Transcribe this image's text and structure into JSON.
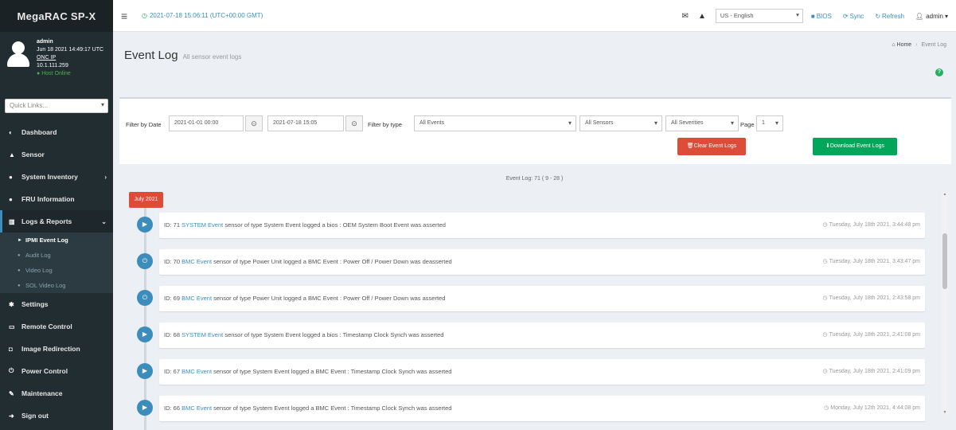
{
  "app": {
    "brand": "MegaRAC SP-X"
  },
  "user_panel": {
    "name": "admin",
    "datetime": "Jun 18 2021 14:49:17 UTC",
    "link": "ONC IP",
    "ip": "10.1.111.259",
    "status": "Host Online"
  },
  "sidebar": {
    "quicklinks_placeholder": "Quick Links...",
    "items": [
      {
        "label": "Dashboard",
        "icon": "tachometer-icon"
      },
      {
        "label": "Sensor",
        "icon": "sensor-icon"
      },
      {
        "label": "System Inventory",
        "icon": "info-icon",
        "arrow": "›"
      },
      {
        "label": "FRU Information",
        "icon": "info-icon"
      },
      {
        "label": "Logs & Reports",
        "icon": "chart-icon",
        "arrow": "⌄"
      },
      {
        "label": "Settings",
        "icon": "gear-icon"
      },
      {
        "label": "Remote Control",
        "icon": "monitor-icon"
      },
      {
        "label": "Image Redirection",
        "icon": "image-icon"
      },
      {
        "label": "Power Control",
        "icon": "power-icon"
      },
      {
        "label": "Maintenance",
        "icon": "wrench-icon"
      },
      {
        "label": "Sign out",
        "icon": "signout-icon"
      }
    ],
    "subitems": [
      {
        "label": "IPMI Event Log"
      },
      {
        "label": "Audit Log"
      },
      {
        "label": "Video Log"
      },
      {
        "label": "SOL Video Log"
      }
    ]
  },
  "header": {
    "timestamp": "2021-07-18 15:06:11 (UTC+00:00 GMT)",
    "language": "US - English",
    "bios_label": "BIOS",
    "sync_label": "Sync",
    "refresh_label": "Refresh",
    "user_label": "admin"
  },
  "page": {
    "title": "Event Log",
    "subtitle": "All sensor event logs",
    "breadcrumb_home": "Home",
    "breadcrumb_current": "Event Log"
  },
  "filters": {
    "date_label": "Filter by Date",
    "start_date": "2021-01-01 00:00",
    "end_date": "2021-07-18 15:05",
    "type_label": "Filter by type",
    "type_value": "All Events",
    "sensor_value": "All Sensors",
    "severity_value": "All Severities",
    "page_label": "Page",
    "page_value": "1",
    "clear_label": "Clear Event Logs",
    "download_label": "Download Event Logs"
  },
  "events_summary": {
    "count_text": "Event Log: 71 ( 9 - 28 )",
    "month": "July 2021"
  },
  "events": [
    {
      "id": "ID: 71",
      "source": "SYSTEM Event",
      "message": "sensor of type System Event logged a bios : OEM System Boot Event was asserted",
      "time": "Tuesday, July 18th 2021, 3:44:48 pm"
    },
    {
      "id": "ID: 70",
      "source": "BMC Event",
      "message": "sensor of type Power Unit logged a BMC Event : Power Off / Power Down was deasserted",
      "time": "Tuesday, July 18th 2021, 3:43:47 pm"
    },
    {
      "id": "ID: 69",
      "source": "BMC Event",
      "message": "sensor of type Power Unit logged a BMC Event : Power Off / Power Down was asserted",
      "time": "Tuesday, July 18th 2021, 2:43:58 pm"
    },
    {
      "id": "ID: 68",
      "source": "SYSTEM Event",
      "message": "sensor of type System Event logged a bios : Timestamp Clock Synch was asserted",
      "time": "Tuesday, July 18th 2021, 2:41:08 pm"
    },
    {
      "id": "ID: 67",
      "source": "BMC Event",
      "message": "sensor of type System Event logged a BMC Event : Timestamp Clock Synch was asserted",
      "time": "Tuesday, July 18th 2021, 2:41:09 pm"
    },
    {
      "id": "ID: 66",
      "source": "BMC Event",
      "message": "sensor of type System Event logged a BMC Event : Timestamp Clock Synch was asserted",
      "time": "Monday, July 12th 2021, 4:44:08 pm"
    }
  ],
  "colors": {
    "sidebar_bg": "#222d32",
    "accent": "#3c8dbc",
    "danger": "#dd4b39",
    "success": "#00a65a"
  }
}
